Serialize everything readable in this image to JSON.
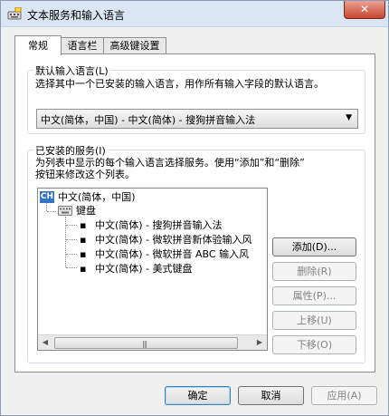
{
  "window": {
    "title": "文本服务和输入语言",
    "close_label": "✕"
  },
  "tabs": [
    {
      "label": "常规",
      "active": true
    },
    {
      "label": "语言栏",
      "active": false
    },
    {
      "label": "高级键设置",
      "active": false
    }
  ],
  "default_language": {
    "group_title": "默认输入语言(L)",
    "description": "选择其中一个已安装的输入语言，用作所有输入字段的默认语言。",
    "selected": "中文(简体，中国) - 中文(简体) - 搜狗拼音输入法"
  },
  "installed_services": {
    "group_title": "已安装的服务(I)",
    "description_line1": "为列表中显示的每个输入语言选择服务。使用“添加”和“删除”",
    "description_line2": "按钮来修改这个列表。",
    "tree": {
      "language_badge": "CH",
      "language": "中文(简体，中国)",
      "category": "键盘",
      "items": [
        "中文(简体) - 搜狗拼音输入法",
        "中文(简体) - 微软拼音新体验输入风",
        "中文(简体) - 微软拼音 ABC 输入风",
        "中文(简体) - 美式键盘"
      ]
    },
    "buttons": {
      "add": "添加(D)...",
      "remove": "删除(R)",
      "properties": "属性(P)...",
      "move_up": "上移(U)",
      "move_down": "下移(O)"
    }
  },
  "footer": {
    "ok": "确定",
    "cancel": "取消",
    "apply": "应用(A)"
  }
}
